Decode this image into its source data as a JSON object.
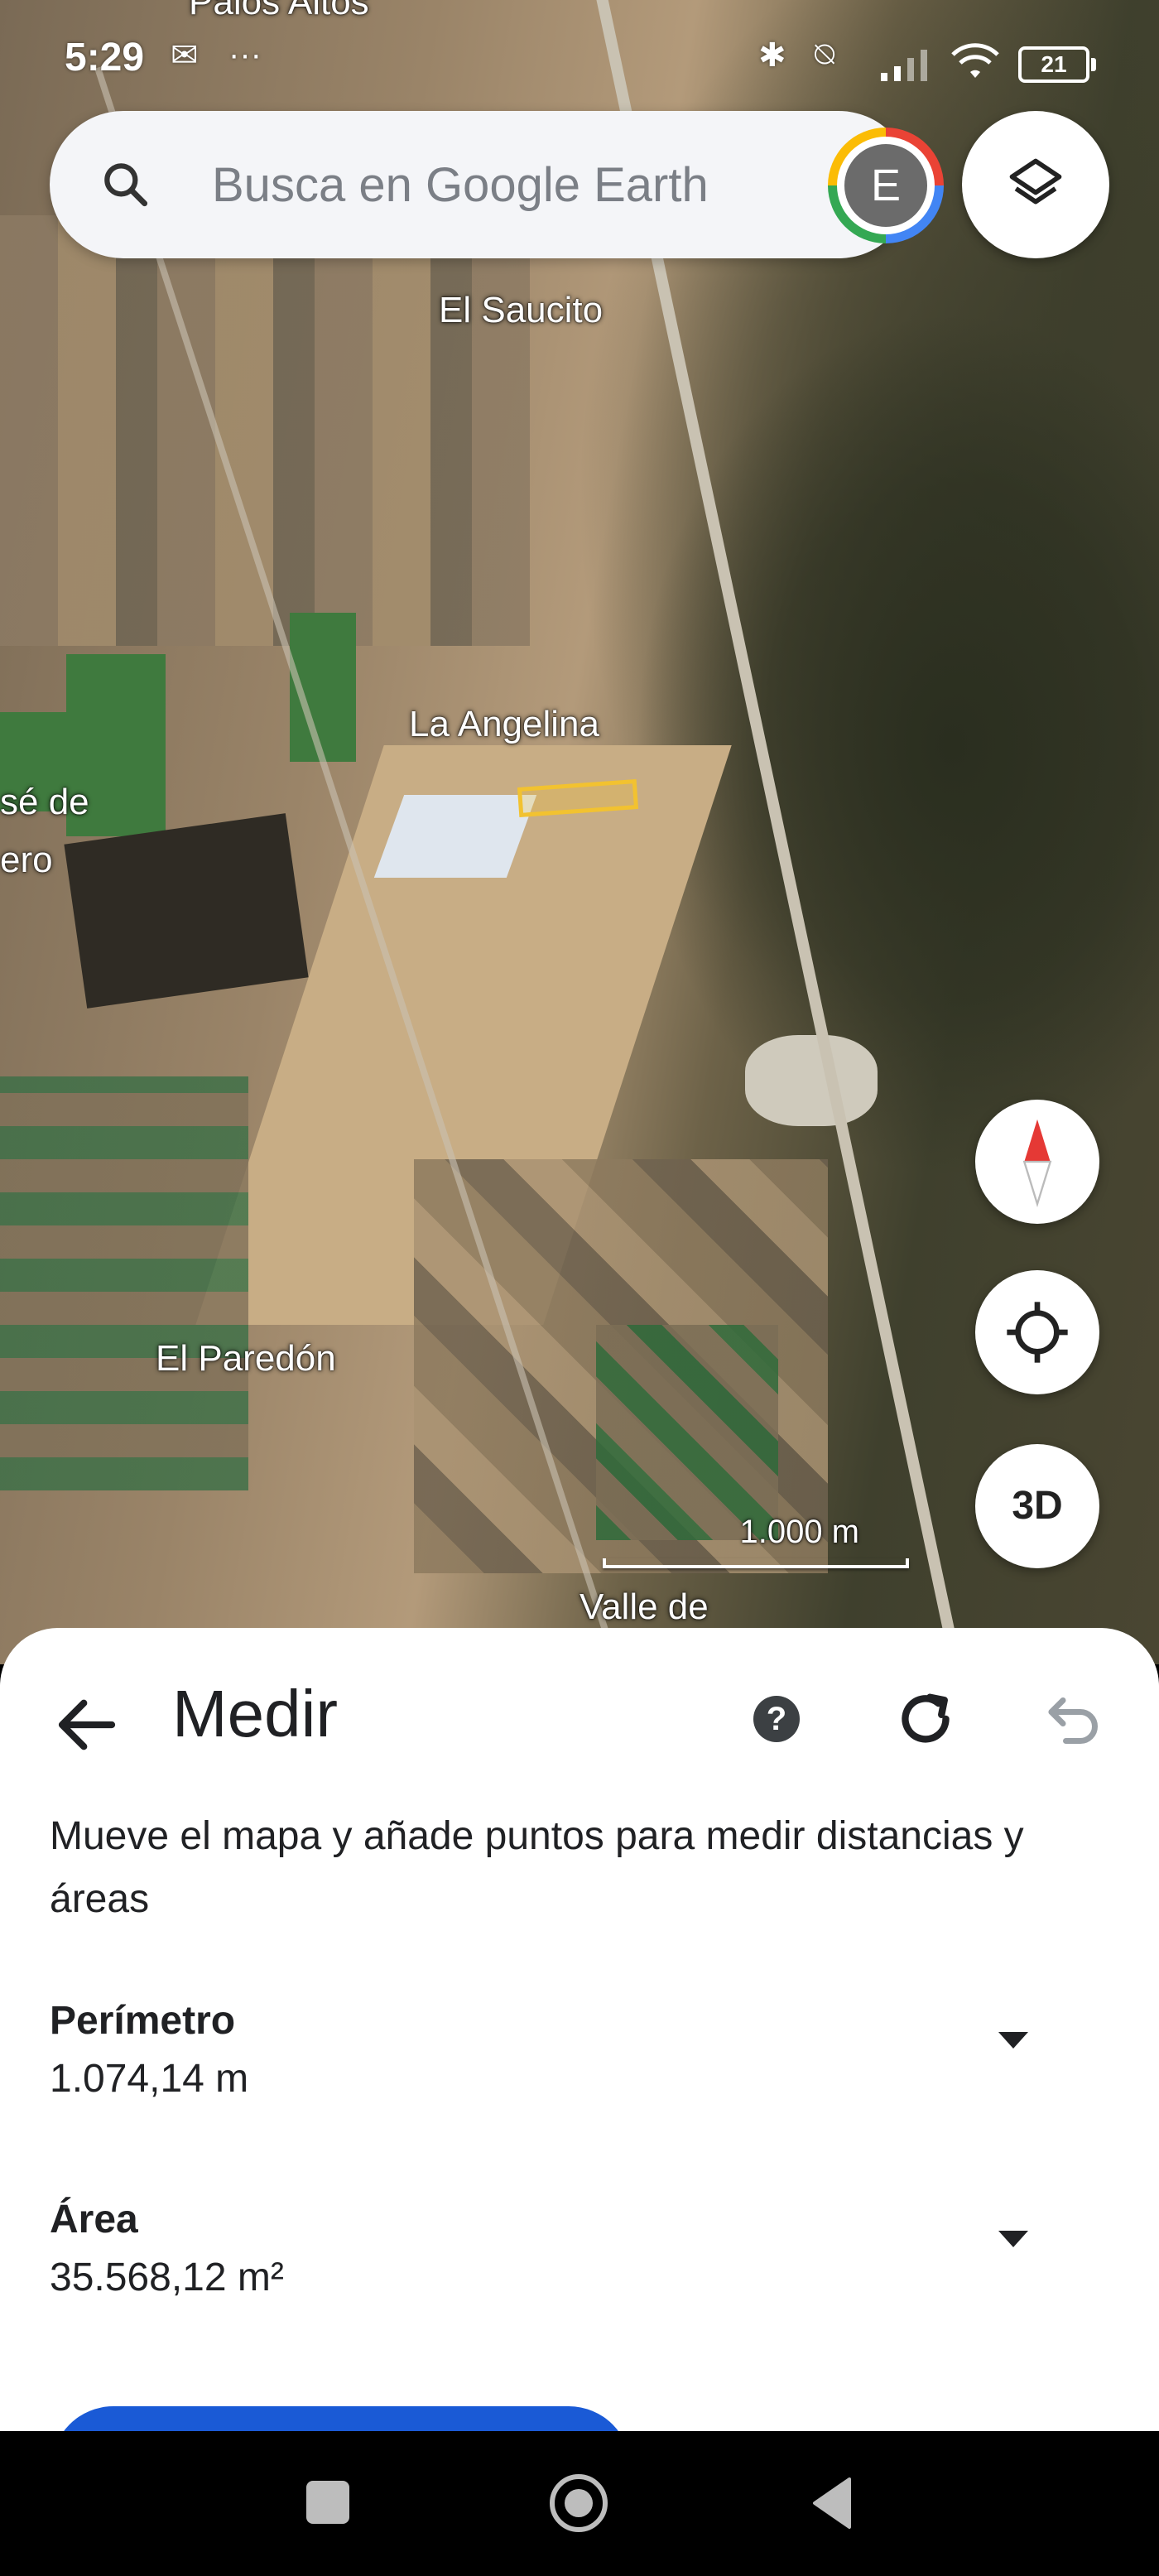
{
  "status_bar": {
    "time": "5:29",
    "battery": "21",
    "icons": [
      "notification-icon",
      "more-icon",
      "bluetooth-icon",
      "vibrate-off-icon",
      "signal-icon",
      "wifi-icon",
      "battery-icon"
    ]
  },
  "search": {
    "placeholder": "Busca en Google Earth",
    "avatar_letter": "E"
  },
  "map": {
    "labels": {
      "el_saucito": "El Saucito",
      "la_angelina": "La Angelina",
      "se_de": "sé de",
      "ero": "ero",
      "el_paredon": "El Paredón",
      "valle_de": "Valle de",
      "top_partial": "Palos Altos"
    },
    "scale_label": "1.000 m",
    "btn_3d": "3D"
  },
  "sheet": {
    "title": "Medir",
    "help_label": "?",
    "instructions": "Mueve el mapa y añade puntos para medir distancias y áreas",
    "perimeter": {
      "label": "Perímetro",
      "value": "1.074,14 m"
    },
    "area": {
      "label": "Área",
      "value": "35.568,12 m²"
    }
  },
  "colors": {
    "accent_blue": "#1a5ad6",
    "measure_yellow": "#f2c230",
    "compass_red": "#e53935"
  }
}
